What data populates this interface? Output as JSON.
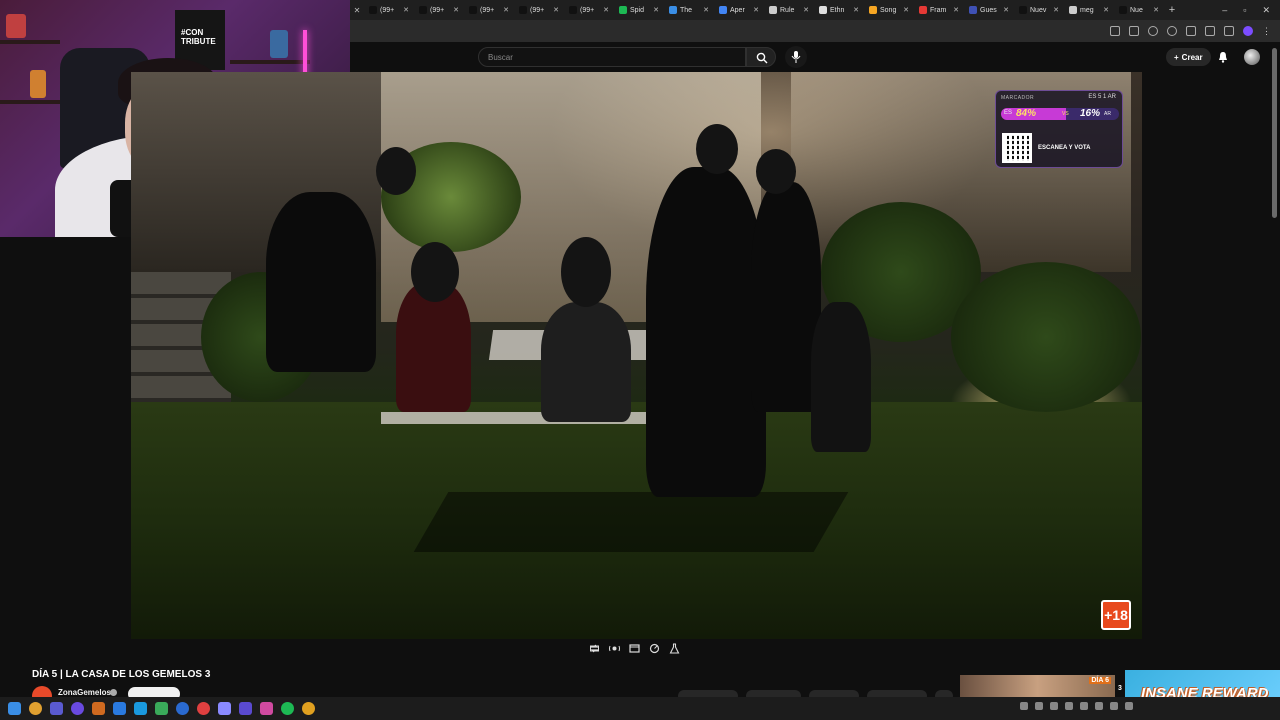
{
  "browser": {
    "tabs": [
      {
        "label": "(99+",
        "color": "#111111"
      },
      {
        "label": "(99+",
        "color": "#111111"
      },
      {
        "label": "(99+",
        "color": "#111111"
      },
      {
        "label": "(99+",
        "color": "#111111"
      },
      {
        "label": "(99+",
        "color": "#111111"
      },
      {
        "label": "Spid",
        "color": "#1db954"
      },
      {
        "label": "The",
        "color": "#3a8ee6"
      },
      {
        "label": "Aper",
        "color": "#4285f4"
      },
      {
        "label": "Rule",
        "color": "#cccccc"
      },
      {
        "label": "Ethn",
        "color": "#dddddd"
      },
      {
        "label": "Song",
        "color": "#f5a623"
      },
      {
        "label": "Fram",
        "color": "#e53935"
      },
      {
        "label": "Gues",
        "color": "#3f51b5"
      },
      {
        "label": "Nuev",
        "color": "#111111"
      },
      {
        "label": "meg",
        "color": "#cccccc"
      },
      {
        "label": "Nue",
        "color": "#111111"
      }
    ],
    "window_controls": [
      "–",
      "▫",
      "✕"
    ]
  },
  "youtube": {
    "search_placeholder": "Buscar",
    "create_label": "Crear"
  },
  "overlay": {
    "scoreboard_header": "MARCADOR",
    "day_info": "ES 5  1 AR",
    "left_label": "ES",
    "left_pct": "84%",
    "vs_label": "VS",
    "right_pct": "16%",
    "right_label": "AR",
    "cta": "ESCANEA Y VOTA",
    "rating": "+18"
  },
  "cam": {
    "shirt_text": "#CON TRIBUTE"
  },
  "video_info": {
    "title": "DÍA 5 | LA CASA DE LOS GEMELOS 3",
    "channel": "ZonaGemelos"
  },
  "sidebar": {
    "thumb_badge": "DÍA 6",
    "thumb_number": "3",
    "ad_text": "INSANE REWARD"
  },
  "colors": {
    "background": "#0f0f0f",
    "score_es": "#c73ad6",
    "rating_badge": "#e8491d",
    "ad_bg": "#3ab0e0"
  }
}
